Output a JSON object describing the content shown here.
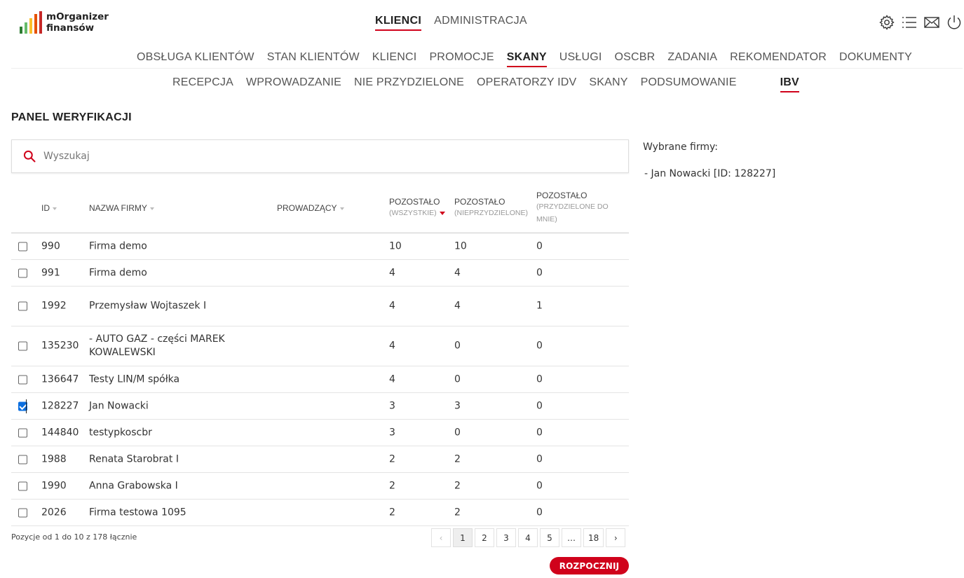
{
  "app": {
    "logo_line1": "mOrganizer",
    "logo_line2": "finansów",
    "logo_bar_colors": [
      "#2e7d32",
      "#66bb6a",
      "#fbc02d",
      "#e65100",
      "#c62828"
    ]
  },
  "topnav": [
    {
      "label": "KLIENCI",
      "active": true
    },
    {
      "label": "ADMINISTRACJA",
      "active": false
    }
  ],
  "header_icons": [
    "gear-icon",
    "menu-list-icon",
    "mail-icon",
    "power-icon"
  ],
  "nav2": [
    {
      "label": "OBSŁUGA KLIENTÓW",
      "active": false
    },
    {
      "label": "STAN KLIENTÓW",
      "active": false
    },
    {
      "label": "KLIENCI",
      "active": false
    },
    {
      "label": "PROMOCJE",
      "active": false
    },
    {
      "label": "SKANY",
      "active": true
    },
    {
      "label": "USŁUGI",
      "active": false
    },
    {
      "label": "OSCBR",
      "active": false
    },
    {
      "label": "ZADANIA",
      "active": false
    },
    {
      "label": "REKOMENDATOR",
      "active": false
    },
    {
      "label": "DOKUMENTY",
      "active": false
    }
  ],
  "nav3": [
    {
      "label": "RECEPCJA",
      "active": false
    },
    {
      "label": "WPROWADZANIE",
      "active": false
    },
    {
      "label": "NIE PRZYDZIELONE",
      "active": false
    },
    {
      "label": "OPERATORZY IDV",
      "active": false
    },
    {
      "label": "SKANY",
      "active": false
    },
    {
      "label": "PODSUMOWANIE",
      "active": false
    },
    {
      "label": "IBV",
      "active": true
    }
  ],
  "page_title": "PANEL WERYFIKACJI",
  "search": {
    "placeholder": "Wyszukaj",
    "value": ""
  },
  "table": {
    "columns": {
      "id": "ID",
      "name": "NAZWA FIRMY",
      "owner": "PROWADZĄCY",
      "all": "POZOSTAŁO",
      "all_sub": "(WSZYSTKIE)",
      "unassigned": "POZOSTAŁO",
      "unassigned_sub": "(NIEPRZYDZIELONE)",
      "mine": "POZOSTAŁO",
      "mine_sub": "(PRZYDZIELONE DO MNIE)"
    },
    "rows": [
      {
        "checked": false,
        "id": "990",
        "name": "Firma demo",
        "owner": "",
        "all": "10",
        "unassigned": "10",
        "mine": "0"
      },
      {
        "checked": false,
        "id": "991",
        "name": "Firma demo",
        "owner": "",
        "all": "4",
        "unassigned": "4",
        "mine": "0"
      },
      {
        "checked": false,
        "id": "1992",
        "name": "Przemysław Wojtaszek I",
        "owner": "",
        "all": "4",
        "unassigned": "4",
        "mine": "1"
      },
      {
        "checked": false,
        "id": "135230",
        "name": "- AUTO GAZ - części MAREK KOWALEWSKI",
        "owner": "",
        "all": "4",
        "unassigned": "0",
        "mine": "0"
      },
      {
        "checked": false,
        "id": "136647",
        "name": "Testy LIN/M spółka",
        "owner": "",
        "all": "4",
        "unassigned": "0",
        "mine": "0"
      },
      {
        "checked": true,
        "id": "128227",
        "name": "Jan Nowacki",
        "owner": "",
        "all": "3",
        "unassigned": "3",
        "mine": "0"
      },
      {
        "checked": false,
        "id": "144840",
        "name": "testypkoscbr",
        "owner": "",
        "all": "3",
        "unassigned": "0",
        "mine": "0"
      },
      {
        "checked": false,
        "id": "1988",
        "name": "Renata Starobrat I",
        "owner": "",
        "all": "2",
        "unassigned": "2",
        "mine": "0"
      },
      {
        "checked": false,
        "id": "1990",
        "name": "Anna Grabowska I",
        "owner": "",
        "all": "2",
        "unassigned": "2",
        "mine": "0"
      },
      {
        "checked": false,
        "id": "2026",
        "name": "Firma testowa 1095",
        "owner": "",
        "all": "2",
        "unassigned": "2",
        "mine": "0"
      }
    ]
  },
  "footer_info": "Pozycje od 1 do 10 z 178 łącznie",
  "pagination": {
    "prev": "‹",
    "pages": [
      "1",
      "2",
      "3",
      "4",
      "5",
      "…",
      "18"
    ],
    "current": "1",
    "next": "›"
  },
  "start_button": "ROZPOCZNIJ",
  "selected": {
    "title": "Wybrane firmy:",
    "items": [
      "- Jan Nowacki [ID: 128227]"
    ]
  },
  "colors": {
    "accent": "#d0021b",
    "checkbox": "#0b6fe0"
  }
}
